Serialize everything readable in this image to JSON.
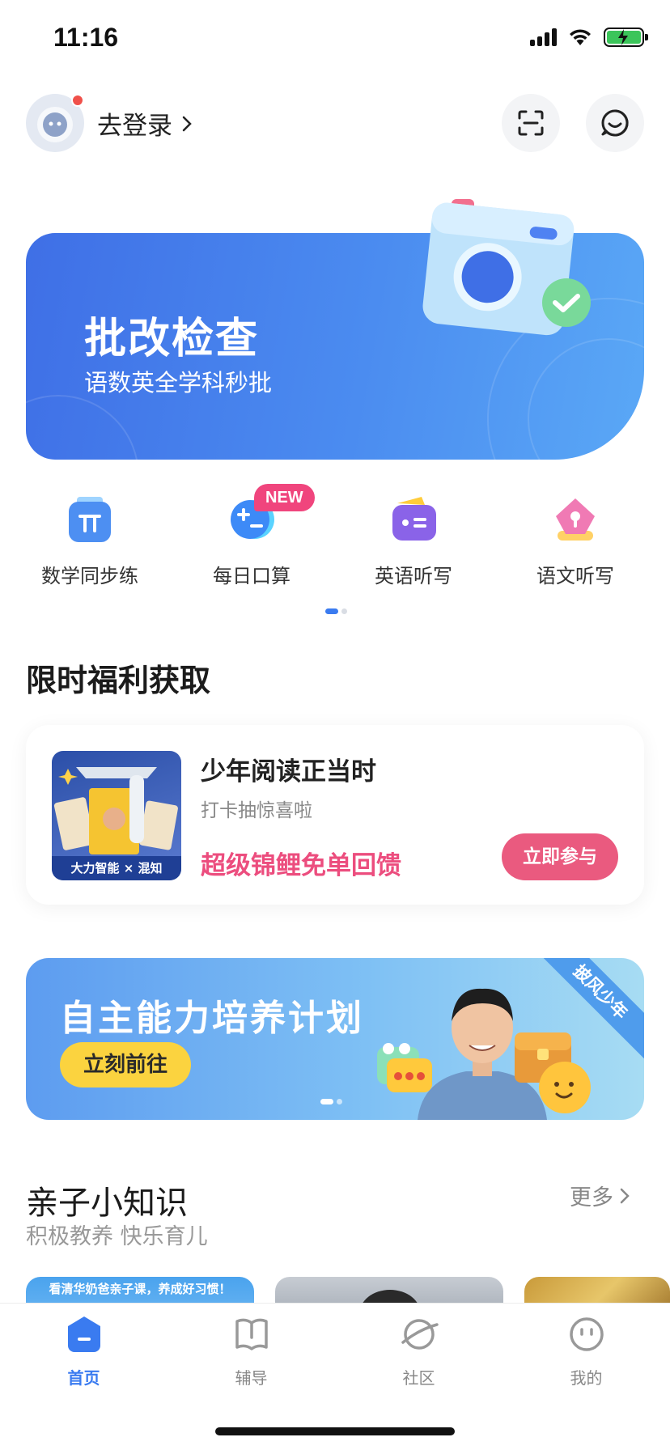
{
  "status_bar": {
    "time": "11:16"
  },
  "header": {
    "login_label": "去登录"
  },
  "hero": {
    "title": "批改检查",
    "subtitle": "语数英全学科秒批"
  },
  "features": [
    {
      "label": "数学同步练",
      "icon": "pi-icon",
      "color": "#4d8ff2"
    },
    {
      "label": "每日口算",
      "icon": "calc-icon",
      "color": "#3d8af7",
      "badge": "NEW"
    },
    {
      "label": "英语听写",
      "icon": "english-dictation-icon",
      "color": "#8a63e8"
    },
    {
      "label": "语文听写",
      "icon": "chinese-dictation-icon",
      "color": "#f07ab4"
    }
  ],
  "welfare": {
    "section_title": "限时福利获取",
    "thumb_caption": "大力智能 × 混知",
    "title": "少年阅读正当时",
    "subtitle": "打卡抽惊喜啦",
    "highlight": "超级锦鲤免单回馈",
    "button": "立即参与"
  },
  "promo": {
    "title": "自主能力培养计划",
    "button": "立刻前往",
    "ribbon": "披风少年"
  },
  "knowledge": {
    "title": "亲子小知识",
    "subtitle": "积极教养 快乐育儿",
    "more": "更多",
    "cards": [
      {
        "caption": "看清华奶爸亲子课，养成好习惯！"
      },
      {
        "caption": ""
      },
      {
        "caption": ""
      }
    ]
  },
  "tabs": [
    {
      "label": "首页",
      "active": true
    },
    {
      "label": "辅导",
      "active": false
    },
    {
      "label": "社区",
      "active": false
    },
    {
      "label": "我的",
      "active": false
    }
  ],
  "colors": {
    "accent": "#3a7bf0",
    "pink": "#ec4d7e",
    "yellow": "#fbd33f"
  }
}
